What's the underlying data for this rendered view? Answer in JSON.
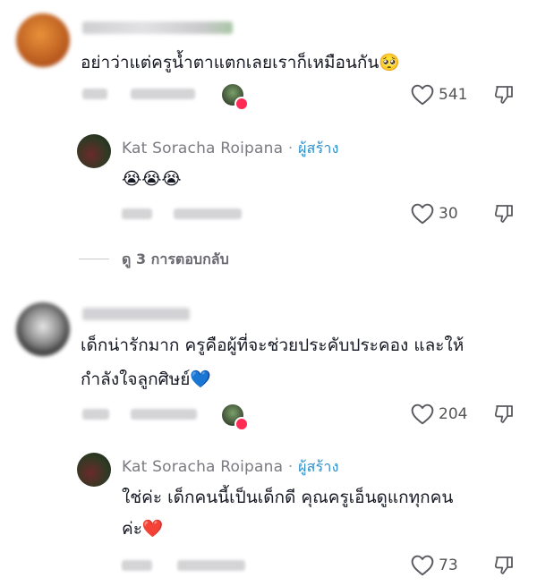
{
  "comments": [
    {
      "text": "อย่าว่าแต่ครูน้ำตาแตกเลยเราก็เหมือนกัน🥺",
      "likes": "541",
      "replies": [
        {
          "author": "Kat Soracha Roipana",
          "creator_label": "ผู้สร้าง",
          "text": "😭😭😭",
          "likes": "30"
        }
      ],
      "view_replies": "ดู 3 การตอบกลับ"
    },
    {
      "text_line1": "เด็กน่ารักมาก ครูคือผู้ที่จะช่วยประคับประคอง และให้",
      "text_line2": "กำลังใจลูกศิษย์💙",
      "likes": "204",
      "replies": [
        {
          "author": "Kat Soracha Roipana",
          "creator_label": "ผู้สร้าง",
          "text_line1": "ใช่ค่ะ เด็กคนนี้เป็นเด็กดี คุณครูเอ็นดูแกทุกคน",
          "text_line2": "ค่ะ❤️",
          "likes": "73"
        }
      ]
    }
  ],
  "icons": {
    "like": "heart-outline-icon",
    "dislike": "thumbs-down-icon",
    "liked_by_creator": "creator-liked-badge"
  },
  "colors": {
    "creator": "#2e8fc9",
    "heart_badge": "#fe2c55",
    "text": "#161823",
    "meta": "#8a8b91"
  }
}
